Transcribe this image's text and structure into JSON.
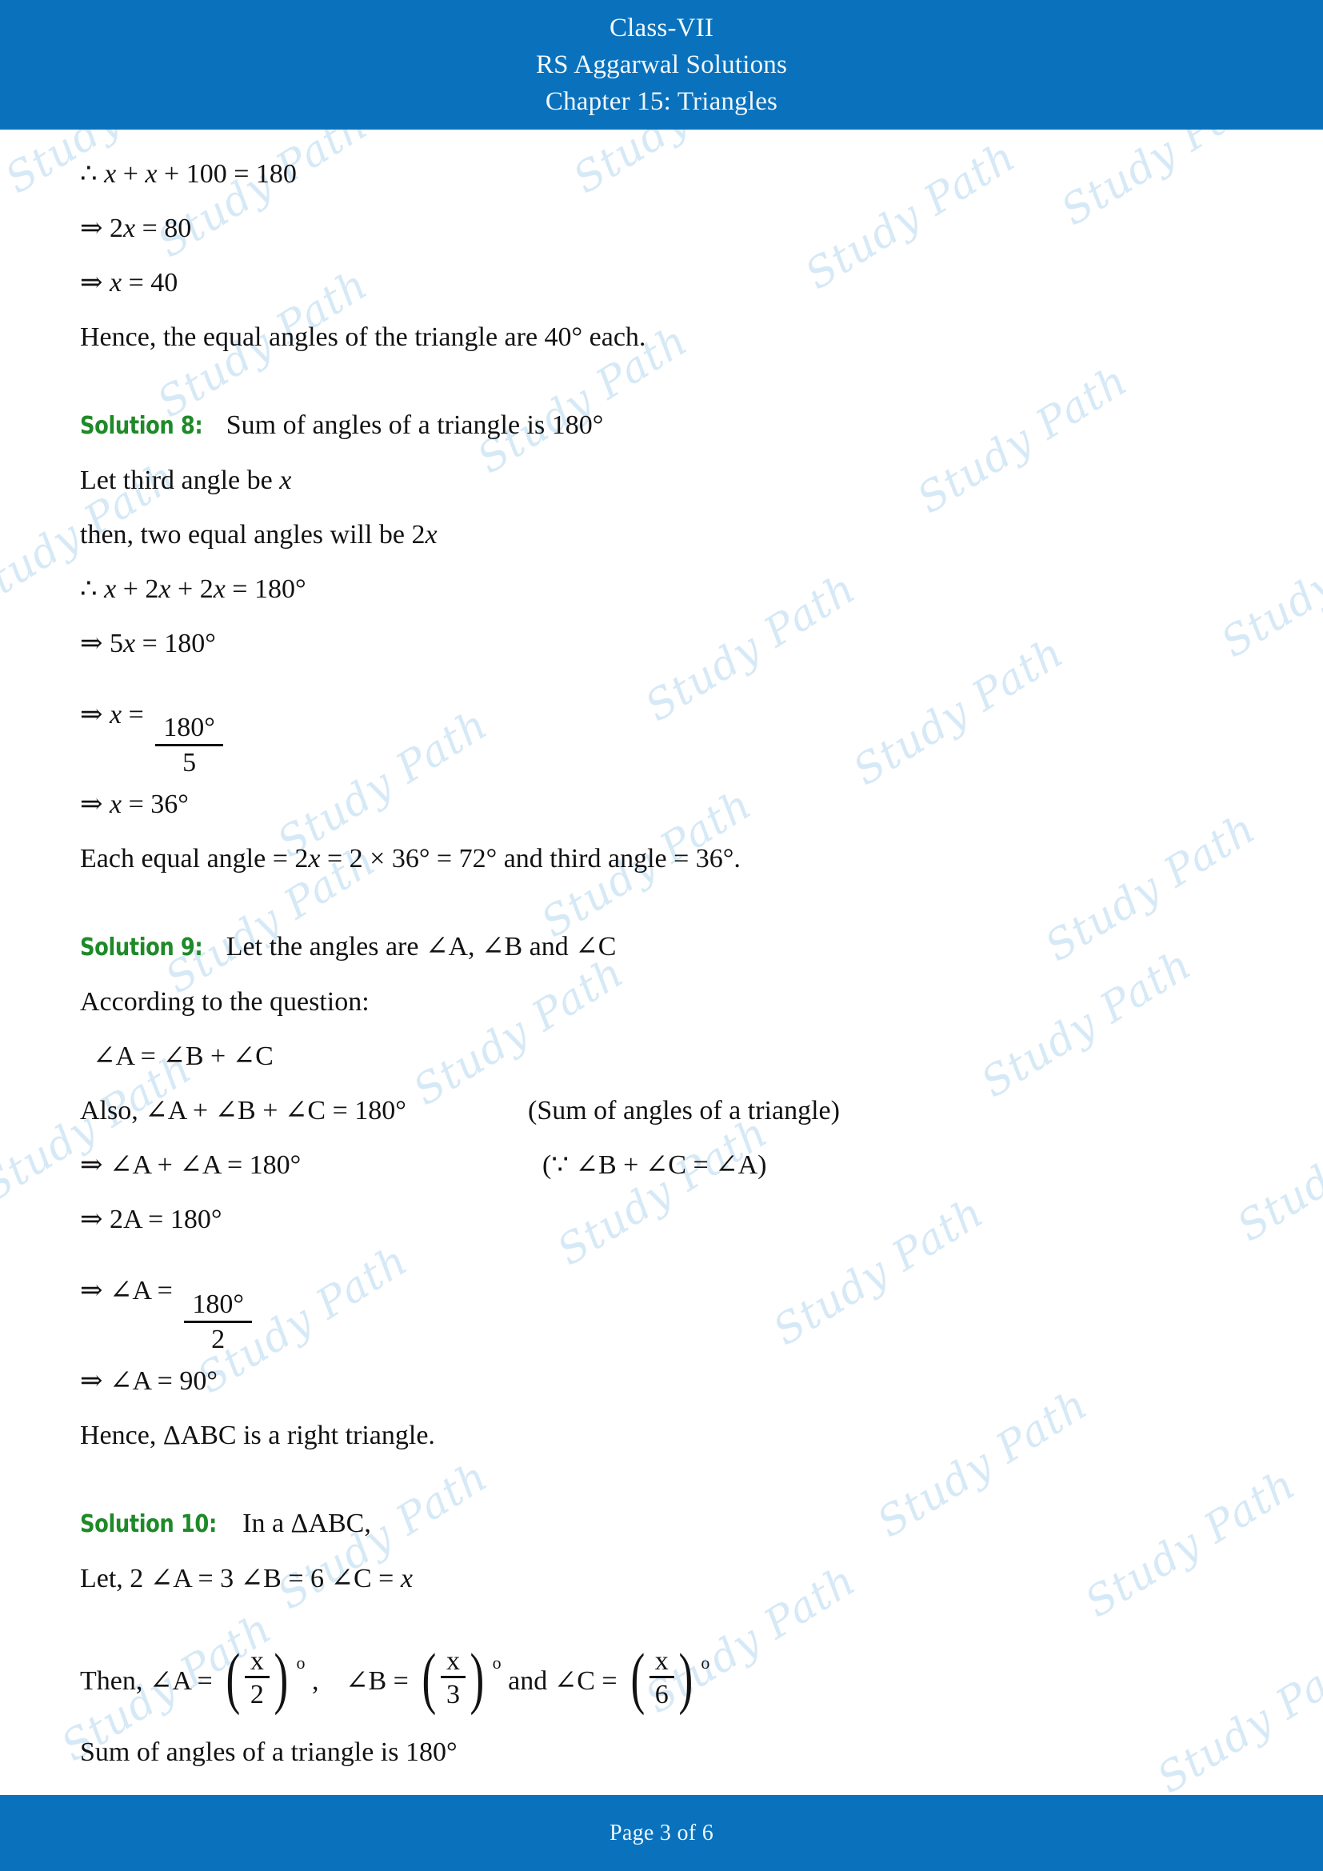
{
  "header": {
    "line1": "Class-VII",
    "line2": "RS Aggarwal Solutions",
    "line3": "Chapter 15: Triangles"
  },
  "footer": {
    "page_text": "Page 3 of 6"
  },
  "colors": {
    "bar_blue": "#0a72bd",
    "solution_green": "#1e8a28",
    "body_text": "#121212",
    "watermark_blue": "#cfe6f5",
    "page_background": "#ffffff"
  },
  "watermark": {
    "text": "Study Path"
  },
  "body": {
    "carryover_solution_7": {
      "l1": "∴ x + x + 100 = 180",
      "l2": "⇒ 2x = 80",
      "l3": "⇒ x = 40",
      "l4": "Hence, the equal angles of the triangle are 40° each."
    },
    "solution_8": {
      "label": "Solution 8:",
      "l1_rest": "Sum of angles of a triangle is 180°",
      "l2": "Let third angle be x",
      "l3": "then, two equal angles will be 2x",
      "l4": "∴ x + 2x + 2x = 180°",
      "l5": "⇒ 5x = 180°",
      "l6_lead": "⇒ x =",
      "l6_num": "180°",
      "l6_den": "5",
      "l7": "⇒ x = 36°",
      "l8": "Each equal angle = 2x = 2 × 36° = 72° and third angle = 36°."
    },
    "solution_9": {
      "label": "Solution 9:",
      "l1_rest": "Let the angles are ∠A, ∠B and ∠C",
      "l2": "According to the question:",
      "l3": "∠A = ∠B + ∠C",
      "l4": "Also,  ∠A + ∠B + ∠C = 180°",
      "l4_note": "(Sum of angles of a triangle)",
      "l5": "⇒ ∠A + ∠A = 180°",
      "l5_note": "(∵ ∠B + ∠C = ∠A)",
      "l6": "⇒ 2A = 180°",
      "l7_lead": "⇒ ∠A =",
      "l7_num": "180°",
      "l7_den": "2",
      "l8": "⇒ ∠A = 90°",
      "l9": "Hence, ΔABC is a right triangle."
    },
    "solution_10": {
      "label": "Solution 10:",
      "l1_rest": "In a ΔABC,",
      "l2": "Let,   2 ∠A = 3 ∠B = 6 ∠C = x",
      "l3_p1": "Then, ∠A =",
      "l3_f1_num": "x",
      "l3_f1_den": "2",
      "l3_p2": ",",
      "l3_p3": "∠B =",
      "l3_f2_num": "x",
      "l3_f2_den": "3",
      "l3_p4": "and ∠C =",
      "l3_f3_num": "x",
      "l3_f3_den": "6",
      "degree_sup": "o",
      "l4": "Sum of angles of a triangle is 180°"
    }
  }
}
